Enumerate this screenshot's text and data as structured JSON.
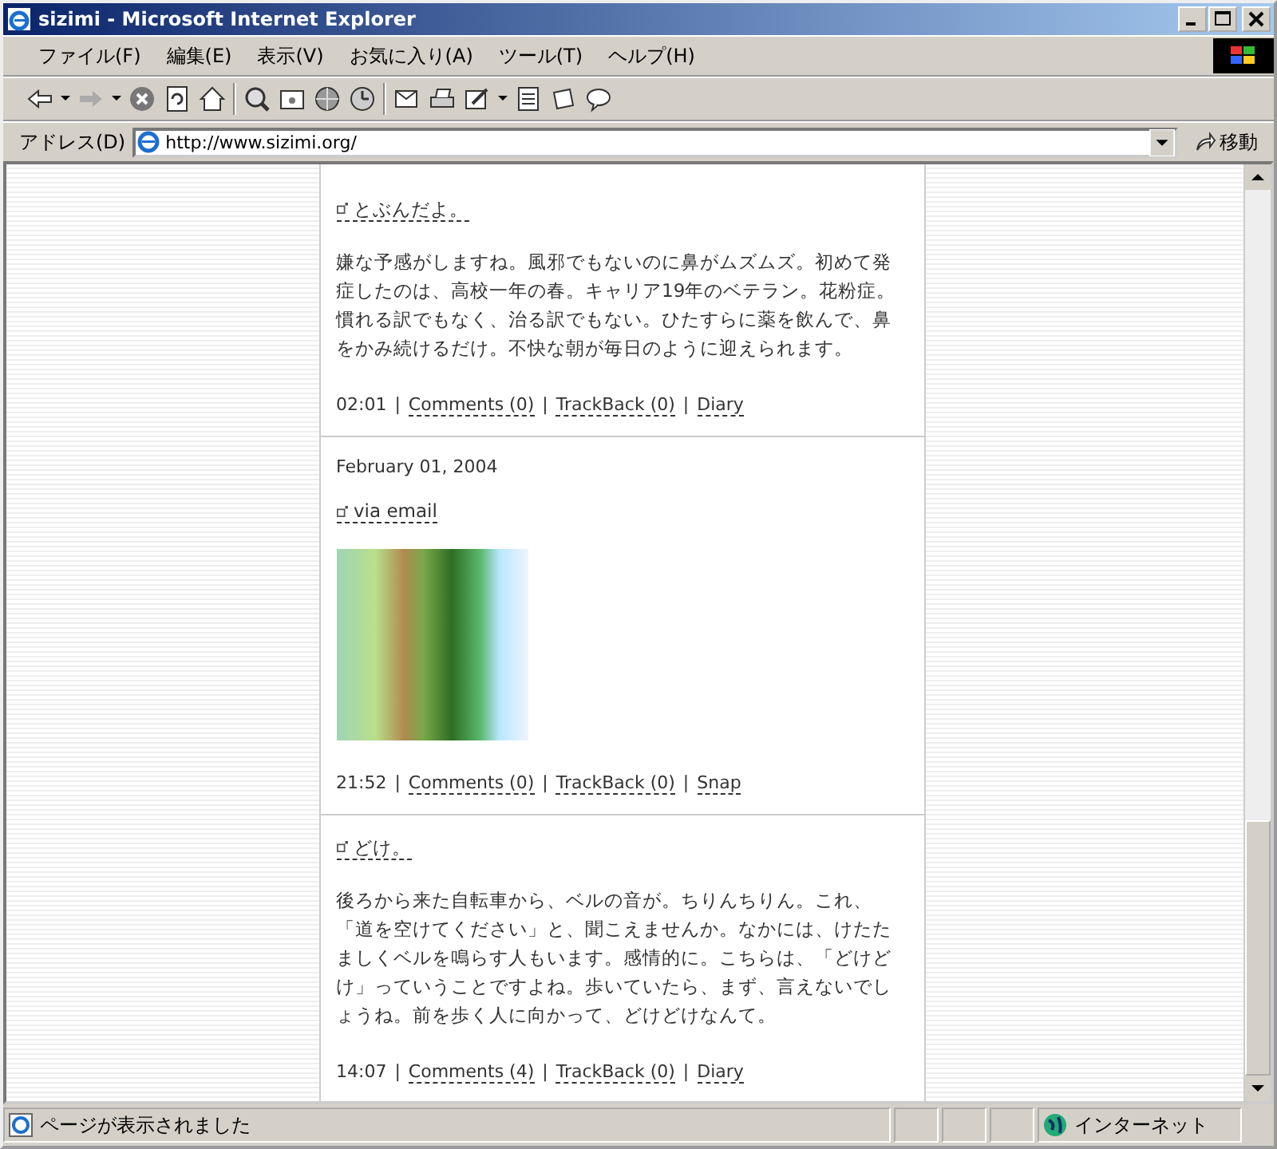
{
  "window": {
    "title": "sizimi - Microsoft Internet Explorer"
  },
  "menu": [
    "ファイル(F)",
    "編集(E)",
    "表示(V)",
    "お気に入り(A)",
    "ツール(T)",
    "ヘルプ(H)"
  ],
  "address": {
    "label": "アドレス(D)",
    "url": "http://www.sizimi.org/",
    "go": "移動"
  },
  "posts": [
    {
      "kind": "text",
      "title": "とぶんだよ。",
      "body": "嫌な予感がしますね。風邪でもないのに鼻がムズムズ。初めて発症したのは、高校一年の春。キャリア19年のベテラン。花粉症。慣れる訳でもなく、治る訳でもない。ひたすらに薬を飲んで、鼻をかみ続けるだけ。不快な朝が毎日のように迎えられます。",
      "footer": [
        {
          "kind": "time",
          "text": "02:01"
        },
        {
          "kind": "sep",
          "text": "|"
        },
        {
          "kind": "link",
          "text": "Comments (0)"
        },
        {
          "kind": "sep",
          "text": "|"
        },
        {
          "kind": "link",
          "text": "TrackBack (0)"
        },
        {
          "kind": "sep",
          "text": "|"
        },
        {
          "kind": "link",
          "text": "Diary"
        }
      ]
    },
    {
      "kind": "photo",
      "date": "February 01, 2004",
      "title": "via email",
      "footer": [
        {
          "kind": "time",
          "text": "21:52"
        },
        {
          "kind": "sep",
          "text": "|"
        },
        {
          "kind": "link",
          "text": "Comments (0)"
        },
        {
          "kind": "sep",
          "text": "|"
        },
        {
          "kind": "link",
          "text": "TrackBack (0)"
        },
        {
          "kind": "sep",
          "text": "|"
        },
        {
          "kind": "link",
          "text": "Snap"
        }
      ]
    },
    {
      "kind": "text",
      "title": "どけ。",
      "body": "後ろから来た自転車から、ベルの音が。ちりんちりん。これ、「道を空けてください」と、聞こえませんか。なかには、けたたましくベルを鳴らす人もいます。感情的に。こちらは、「どけどけ」っていうことですよね。歩いていたら、まず、言えないでしょうね。前を歩く人に向かって、どけどけなんて。",
      "footer": [
        {
          "kind": "time",
          "text": "14:07"
        },
        {
          "kind": "sep",
          "text": "|"
        },
        {
          "kind": "link",
          "text": "Comments (4)"
        },
        {
          "kind": "sep",
          "text": "|"
        },
        {
          "kind": "link",
          "text": "TrackBack (0)"
        },
        {
          "kind": "sep",
          "text": "|"
        },
        {
          "kind": "link",
          "text": "Diary"
        }
      ]
    }
  ],
  "status_bar": {
    "text": "ページが表示されました",
    "zone": "インターネット"
  }
}
